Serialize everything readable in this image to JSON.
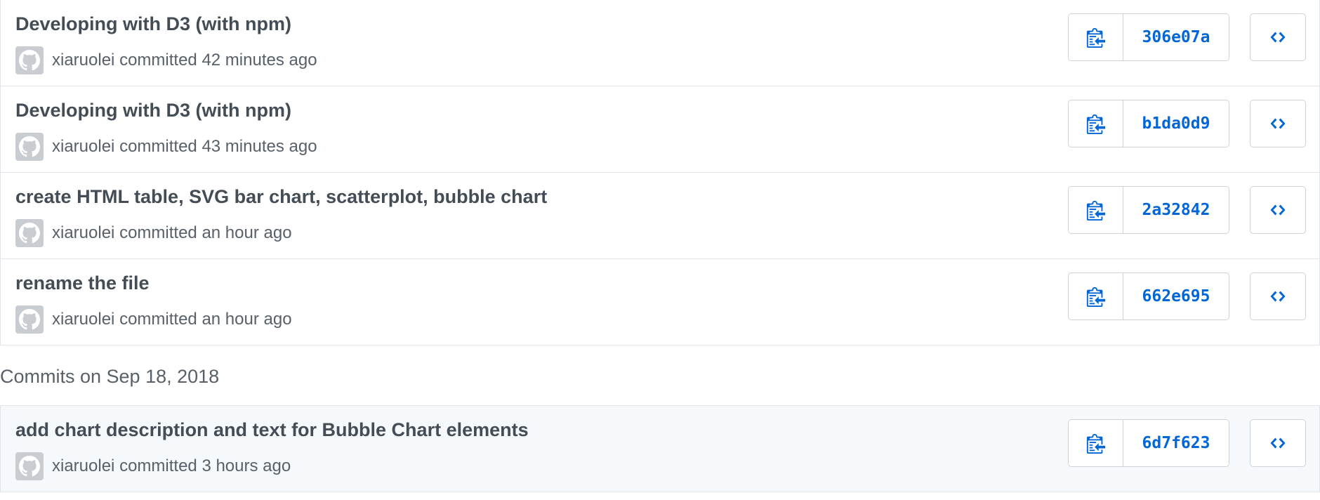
{
  "colors": {
    "link": "#0366d6",
    "title": "#444d56",
    "meta": "#586069",
    "border": "#e1e4e8",
    "highlight_bg": "#f6f9fc"
  },
  "icons": {
    "copy": "clippy-icon",
    "browse": "code-icon",
    "avatar": "github-octocat-icon"
  },
  "group1": {
    "commits": [
      {
        "title": "Developing with D3 (with npm)",
        "author": "xiaruolei",
        "action": "committed",
        "time": "42 minutes ago",
        "sha": "306e07a"
      },
      {
        "title": "Developing with D3 (with npm)",
        "author": "xiaruolei",
        "action": "committed",
        "time": "43 minutes ago",
        "sha": "b1da0d9"
      },
      {
        "title": "create HTML table, SVG bar chart, scatterplot, bubble chart",
        "author": "xiaruolei",
        "action": "committed",
        "time": "an hour ago",
        "sha": "2a32842"
      },
      {
        "title": "rename the file",
        "author": "xiaruolei",
        "action": "committed",
        "time": "an hour ago",
        "sha": "662e695"
      }
    ]
  },
  "group2": {
    "heading": "Commits on Sep 18, 2018",
    "commits": [
      {
        "title": "add chart description and text for Bubble Chart elements",
        "author": "xiaruolei",
        "action": "committed",
        "time": "3 hours ago",
        "sha": "6d7f623"
      }
    ]
  }
}
